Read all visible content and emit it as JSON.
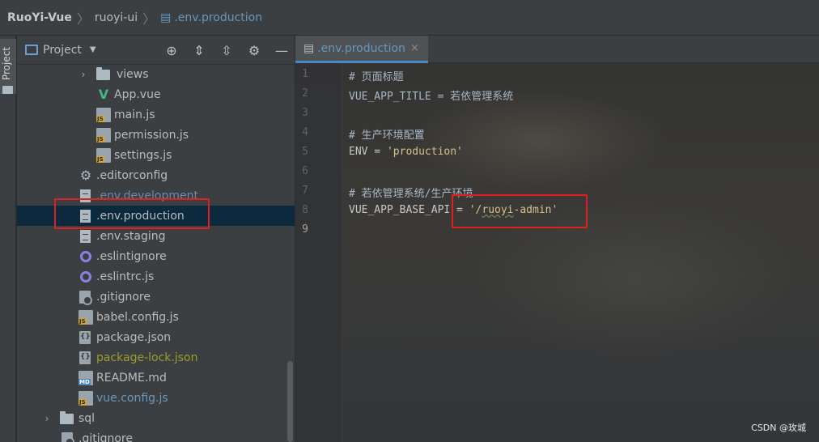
{
  "breadcrumb": {
    "items": [
      "RuoYi-Vue",
      "ruoyi-ui",
      ".env.production"
    ]
  },
  "toolstrip": {
    "project_label": "Project"
  },
  "project_panel": {
    "title": "Project",
    "tree": [
      {
        "label": "views",
        "icon": "folder-icon",
        "arrow": "›"
      },
      {
        "label": "App.vue",
        "icon": "vue-file-icon"
      },
      {
        "label": "main.js",
        "icon": "js-file-icon"
      },
      {
        "label": "permission.js",
        "icon": "js-file-icon"
      },
      {
        "label": "settings.js",
        "icon": "js-file-icon"
      },
      {
        "label": ".editorconfig",
        "icon": "gear-icon"
      },
      {
        "label": ".env.development",
        "icon": "text-file-icon"
      },
      {
        "label": ".env.production",
        "icon": "text-file-icon"
      },
      {
        "label": ".env.staging",
        "icon": "text-file-icon"
      },
      {
        "label": ".eslintignore",
        "icon": "eslint-icon"
      },
      {
        "label": ".eslintrc.js",
        "icon": "eslint-icon"
      },
      {
        "label": ".gitignore",
        "icon": "git-file-icon"
      },
      {
        "label": "babel.config.js",
        "icon": "js-file-icon"
      },
      {
        "label": "package.json",
        "icon": "json-file-icon"
      },
      {
        "label": "package-lock.json",
        "icon": "json-file-icon"
      },
      {
        "label": "README.md",
        "icon": "markdown-file-icon"
      },
      {
        "label": "vue.config.js",
        "icon": "js-file-icon"
      },
      {
        "label": "sql",
        "icon": "folder-icon",
        "arrow": "›"
      },
      {
        "label": ".gitignore",
        "icon": "git-file-icon"
      }
    ],
    "js_badge": "JS",
    "md_badge": "MD"
  },
  "editor": {
    "tab_label": ".env.production",
    "tab_close": "×",
    "line_numbers": [
      "1",
      "2",
      "3",
      "4",
      "5",
      "6",
      "7",
      "8",
      "9"
    ],
    "lines": {
      "l1": "# 页面标题",
      "l2": "VUE_APP_TITLE = 若依管理系统",
      "l4": "# 生产环境配置",
      "l5_key": "ENV = ",
      "l5_val": "'production'",
      "l7": "# 若依管理系统/生产环境",
      "l8_key": "VUE_APP_BASE_API = ",
      "l8_q1": "'/",
      "l8_word": "ruoyi",
      "l8_rest": "-admin'"
    }
  },
  "watermark": "CSDN @玫城",
  "colors": {
    "highlight_box": "#e02020",
    "selection": "#0d293e",
    "file_blue": "#6897bb"
  }
}
